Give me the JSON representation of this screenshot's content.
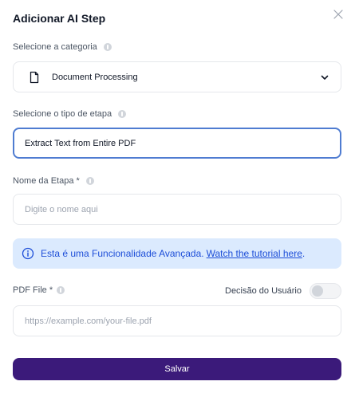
{
  "dialog": {
    "title": "Adicionar AI Step"
  },
  "category": {
    "label": "Selecione a categoria",
    "value": "Document Processing",
    "icon": "document-icon"
  },
  "step_type": {
    "label": "Selecione o tipo de etapa",
    "value": "Extract Text from Entire PDF"
  },
  "step_name": {
    "label": "Nome da Etapa *",
    "value": "",
    "placeholder": "Digite o nome aqui"
  },
  "banner": {
    "text": "Esta é uma Funcionalidade Avançada.",
    "link": "Watch the tutorial here",
    "suffix": ".",
    "color": "#dbeafe",
    "text_color": "#1d4ed8"
  },
  "pdf_file": {
    "label": "PDF File *",
    "value": "",
    "placeholder": "https://example.com/your-file.pdf"
  },
  "user_decision": {
    "label": "Decisão do Usuário",
    "enabled": false
  },
  "actions": {
    "save_label": "Salvar",
    "save_color": "#3b1a7a"
  }
}
